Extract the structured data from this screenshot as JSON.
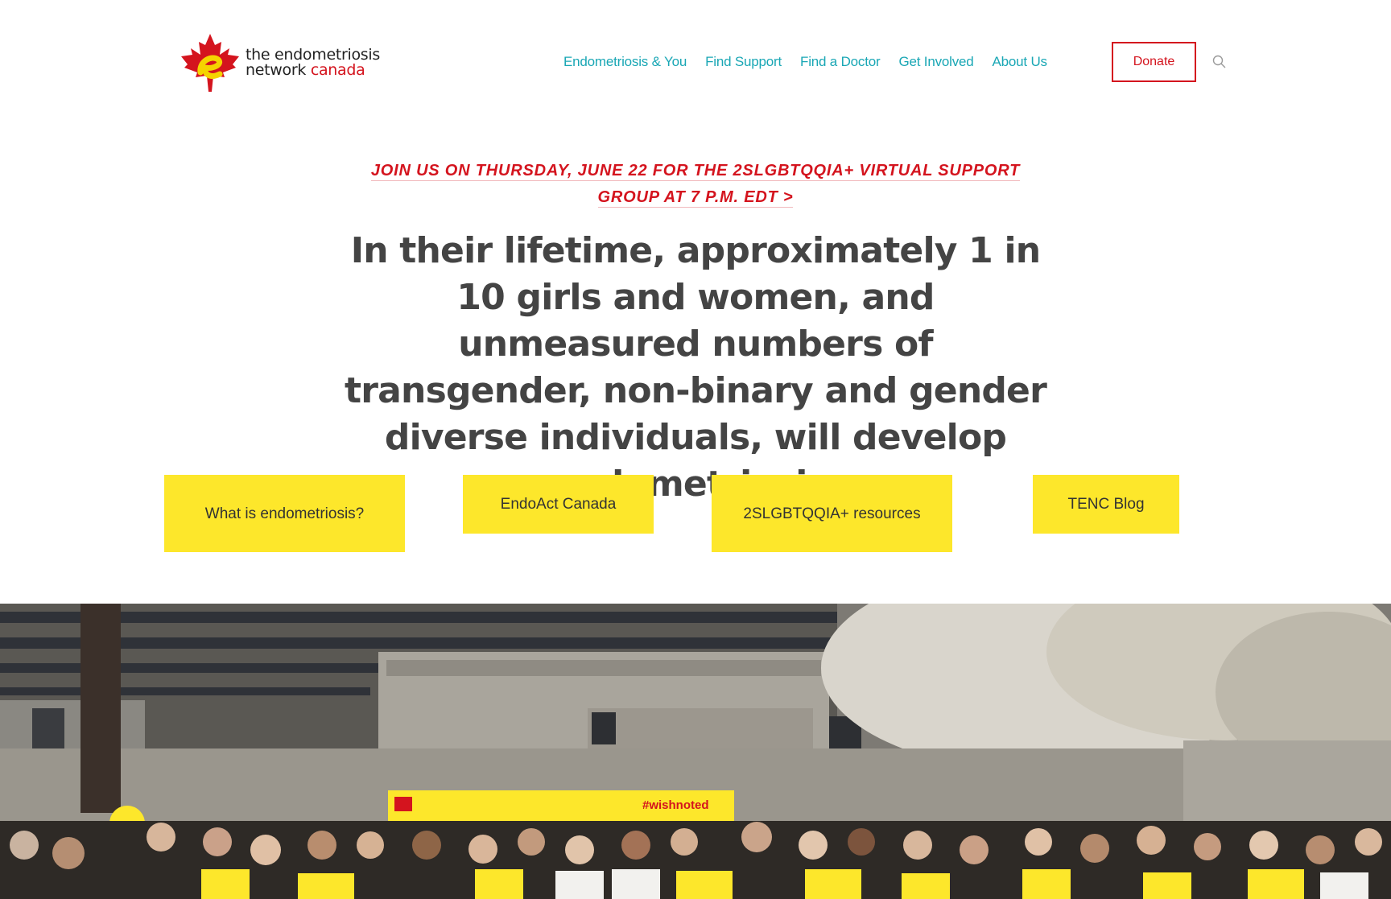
{
  "header": {
    "logo": {
      "line1": "the endometriosis",
      "line2_part1": "network ",
      "line2_part2": "canada",
      "accent_color": "#d4141e",
      "e_color": "#f5d400"
    },
    "nav": [
      {
        "label": "Endometriosis & You"
      },
      {
        "label": "Find Support"
      },
      {
        "label": "Find a Doctor"
      },
      {
        "label": "Get Involved"
      },
      {
        "label": "About Us"
      }
    ],
    "donate_label": "Donate",
    "search_icon": "search-icon"
  },
  "announcement": {
    "line1": "Join us on Thursday, June 22 for the 2SLGBTQQIA+ Virtual Support",
    "line2": "Group at 7 p.m. EDT >"
  },
  "hero": {
    "heading": "In their lifetime, approximately 1 in 10 girls and women, and unmeasured numbers of transgender, non-binary and gender diverse individuals, will develop endometriosis."
  },
  "cta_buttons": [
    {
      "label": "What is endometriosis?"
    },
    {
      "label": "EndoAct Canada"
    },
    {
      "label": "2SLGBTQQIA+ resources"
    },
    {
      "label": "TENC Blog"
    }
  ],
  "photo": {
    "banner_text": "#wishnoted"
  },
  "colors": {
    "teal": "#1aa7b5",
    "red": "#d4141e",
    "yellow": "#fde72b",
    "heading": "#444444"
  }
}
